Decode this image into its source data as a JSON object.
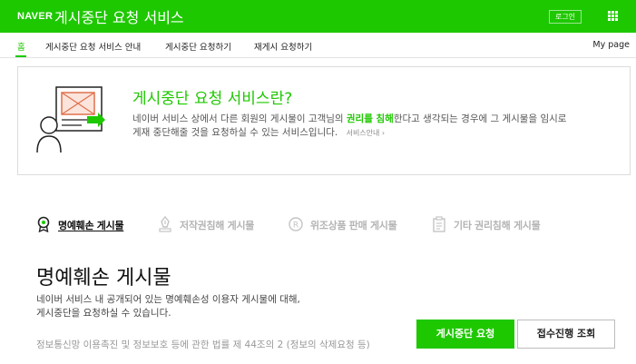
{
  "header": {
    "logo": "NAVER",
    "title": "게시중단 요청 서비스",
    "login_label": "로그인",
    "apps_icon": "grid-icon"
  },
  "nav": {
    "items": [
      {
        "label": "홈",
        "active": true
      },
      {
        "label": "게시중단 요청 서비스 안내",
        "active": false
      },
      {
        "label": "게시중단 요청하기",
        "active": false
      },
      {
        "label": "재게시 요청하기",
        "active": false
      }
    ],
    "mypage": "My page"
  },
  "intro": {
    "title": "게시중단 요청 서비스란?",
    "desc_part1": "네이버 서비스 상에서 다른 회원의 게시물이 고객님의 ",
    "desc_highlight": "권리를 침해",
    "desc_part2": "한다고 생각되는 경우에 그 게시물을 임시로",
    "desc_line2": "게재 중단해줄 것을 요청하실 수 있는 서비스입니다.",
    "guide_link": "서비스안내 ›",
    "accent_color": "#1ec800"
  },
  "categories": [
    {
      "label": "명예훼손 게시물",
      "icon": "medal-icon",
      "active": true
    },
    {
      "label": "저작권침해 게시물",
      "icon": "copyright-pen-icon",
      "active": false
    },
    {
      "label": "위조상품 판매 게시물",
      "icon": "registered-mark-icon",
      "active": false
    },
    {
      "label": "기타 권리침해 게시물",
      "icon": "clipboard-icon",
      "active": false
    }
  ],
  "section": {
    "title": "명예훼손 게시물",
    "desc_line1": "네이버 서비스 내 공개되어 있는 명예훼손성 이용자 게시물에 대해,",
    "desc_line2": "게시중단을 요청하실 수 있습니다.",
    "law_text": "정보통신망 이용촉진 및 정보보호 등에 관한 법률 제 44조의 2 (정보의 삭제요청 등)"
  },
  "buttons": {
    "request": "게시중단 요청",
    "status": "접수진행 조회"
  }
}
